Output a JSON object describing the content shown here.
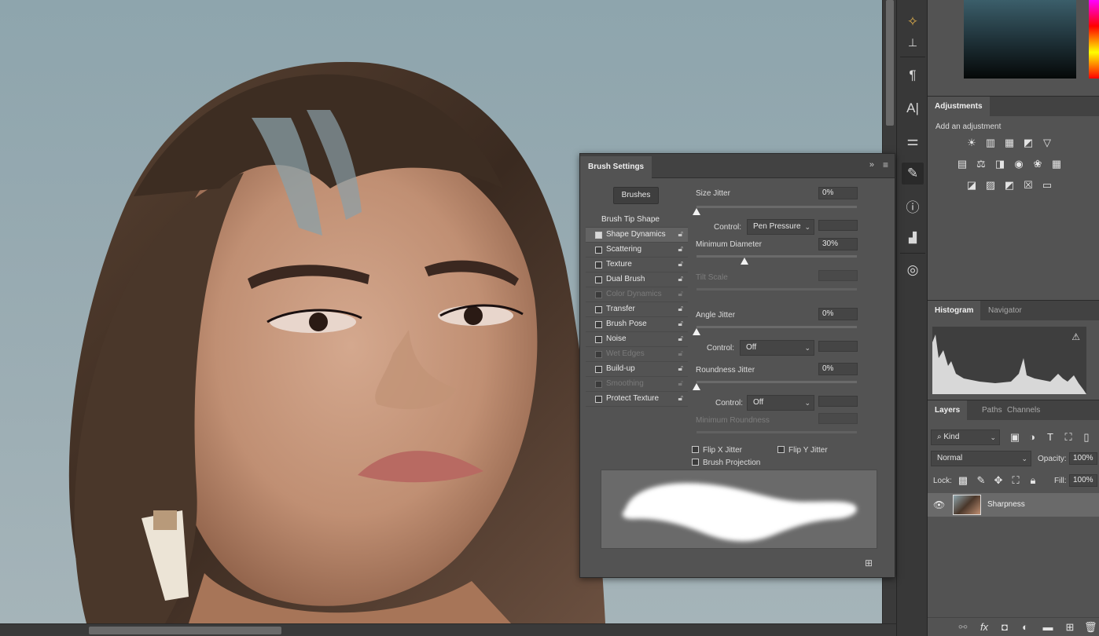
{
  "brush_settings": {
    "title": "Brush Settings",
    "brushes_button": "Brushes",
    "options": [
      {
        "label": "Brush Tip Shape",
        "checkbox": false,
        "checked": false,
        "enabled": true,
        "selected": false
      },
      {
        "label": "Shape Dynamics",
        "checkbox": true,
        "checked": true,
        "enabled": true,
        "selected": true
      },
      {
        "label": "Scattering",
        "checkbox": true,
        "checked": false,
        "enabled": true,
        "selected": false
      },
      {
        "label": "Texture",
        "checkbox": true,
        "checked": false,
        "enabled": true,
        "selected": false
      },
      {
        "label": "Dual Brush",
        "checkbox": true,
        "checked": false,
        "enabled": true,
        "selected": false
      },
      {
        "label": "Color Dynamics",
        "checkbox": true,
        "checked": false,
        "enabled": false,
        "selected": false
      },
      {
        "label": "Transfer",
        "checkbox": true,
        "checked": false,
        "enabled": true,
        "selected": false
      },
      {
        "label": "Brush Pose",
        "checkbox": true,
        "checked": false,
        "enabled": true,
        "selected": false
      },
      {
        "label": "Noise",
        "checkbox": true,
        "checked": false,
        "enabled": true,
        "selected": false
      },
      {
        "label": "Wet Edges",
        "checkbox": true,
        "checked": false,
        "enabled": false,
        "selected": false
      },
      {
        "label": "Build-up",
        "checkbox": true,
        "checked": false,
        "enabled": true,
        "selected": false
      },
      {
        "label": "Smoothing",
        "checkbox": true,
        "checked": false,
        "enabled": false,
        "selected": false
      },
      {
        "label": "Protect Texture",
        "checkbox": true,
        "checked": false,
        "enabled": true,
        "selected": false
      }
    ],
    "size_jitter": {
      "label": "Size Jitter",
      "value": "0%",
      "level": 0
    },
    "control1": {
      "label": "Control:",
      "value": "Pen Pressure"
    },
    "minimum_diameter": {
      "label": "Minimum Diameter",
      "value": "30%",
      "level": 0.3
    },
    "tilt_scale": {
      "label": "Tilt Scale"
    },
    "angle_jitter": {
      "label": "Angle Jitter",
      "value": "0%",
      "level": 0
    },
    "control2": {
      "label": "Control:",
      "value": "Off"
    },
    "roundness_jitter": {
      "label": "Roundness Jitter",
      "value": "0%",
      "level": 0
    },
    "control3": {
      "label": "Control:",
      "value": "Off"
    },
    "minimum_roundness": {
      "label": "Minimum Roundness"
    },
    "flip_x": "Flip X Jitter",
    "flip_y": "Flip Y Jitter",
    "brush_projection": "Brush Projection"
  },
  "adjustments": {
    "tab": "Adjustments",
    "hint": "Add an adjustment"
  },
  "histogram_tabs": [
    "Histogram",
    "Navigator"
  ],
  "layers_tabs": [
    "Layers",
    "Paths",
    "Channels"
  ],
  "layers": {
    "kind_label": "Kind",
    "blend_mode": "Normal",
    "opacity_label": "Opacity:",
    "opacity_value": "100%",
    "lock_label": "Lock:",
    "fill_label": "Fill:",
    "fill_value": "100%",
    "items": [
      {
        "name": "Sharpness",
        "visible": true
      }
    ]
  },
  "colors": {
    "panel_bg": "#535353",
    "tab_bar": "#424242",
    "accent_selected": "#636363"
  }
}
